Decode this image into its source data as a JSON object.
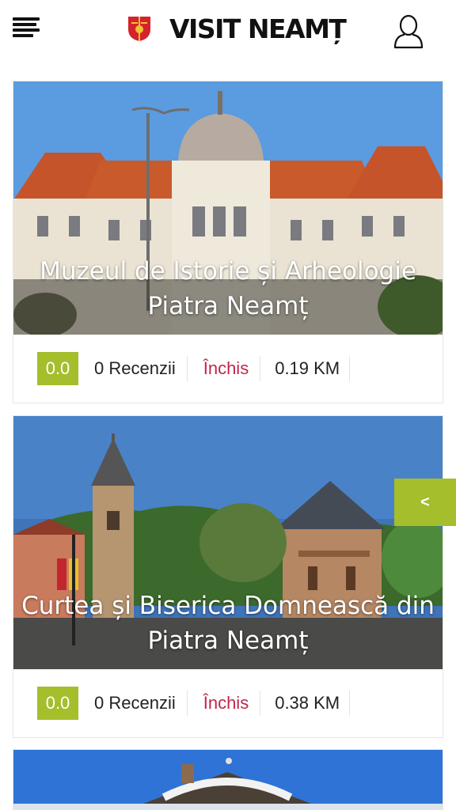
{
  "header": {
    "title": "VISIT NEAMȚ",
    "menu_icon": "hamburger-menu-icon",
    "user_icon": "user-profile-icon",
    "crest_icon": "neamt-crest-icon"
  },
  "colors": {
    "accent": "#a4be2c",
    "closed_status": "#c2264a"
  },
  "listings": [
    {
      "title": "Muzeul de Istorie și Arheologie Piatra Neamț",
      "rating": "0.0",
      "reviews": "0 Recenzii",
      "status": "Închis",
      "distance": "0.19 KM"
    },
    {
      "title": "Curtea și Biserica Domnească din Piatra Neamț",
      "rating": "0.0",
      "reviews": "0 Recenzii",
      "status": "Închis",
      "distance": "0.38 KM"
    },
    {
      "title": "",
      "rating": "",
      "reviews": "",
      "status": "",
      "distance": ""
    }
  ],
  "side_tab": {
    "label": "<",
    "icon": "chevron-left-icon"
  }
}
